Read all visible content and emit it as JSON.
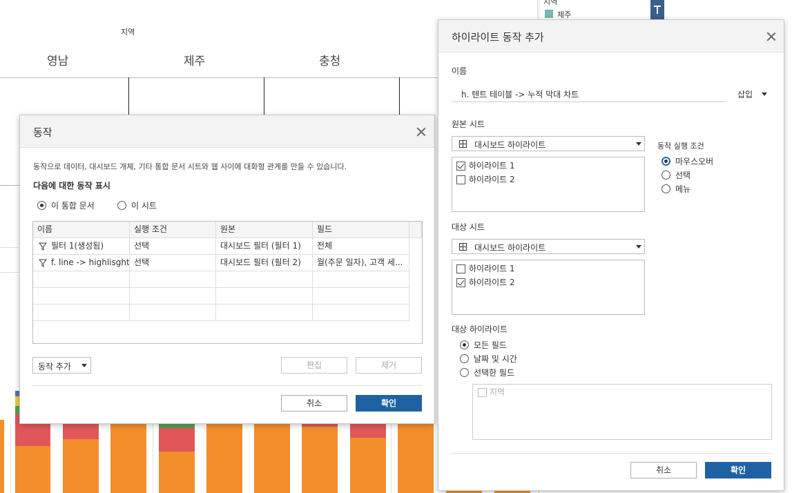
{
  "background": {
    "region_header": "지역",
    "categories": [
      "영남",
      "제주",
      "충청"
    ],
    "legend_title": "지역",
    "legend_item": "제주",
    "stack_colors": {
      "orange": "#f28e2b",
      "red": "#e15759",
      "green": "#59a14f",
      "yellow": "#edc948",
      "blue": "#4e79a7"
    }
  },
  "actions_dialog": {
    "title": "동작",
    "description": "동작으로 데이터, 대시보드 개체, 기타 통합 문서 시트와 웹 사이에 대화형 관계를 만들 수 있습니다.",
    "show_label": "다음에 대한 동작 표시",
    "scope_options": [
      {
        "label": "이 통합 문서",
        "selected": true
      },
      {
        "label": "이 시트",
        "selected": false
      }
    ],
    "table": {
      "columns": [
        "이름",
        "실행 조건",
        "원본",
        "필드"
      ],
      "rows": [
        {
          "name": "필터 1(생성됨)",
          "trigger": "선택",
          "source": "대시보드 필터 (필터 1)",
          "field": "전체"
        },
        {
          "name": "f. line -> highlisght table",
          "trigger": "선택",
          "source": "대시보드 필터 (필터 2)",
          "field": "월(주문 일자), 고객 세..."
        }
      ]
    },
    "add_action": "동작 추가",
    "edit": "편집",
    "remove": "제거",
    "cancel": "취소",
    "ok": "확인"
  },
  "highlight_dialog": {
    "title": "하이라이트 동작 추가",
    "name_label": "이름",
    "name_value": "h. 텐트 테이블  -> 누적 막대 차트",
    "insert": "삽입",
    "source_sheet_label": "원본 시트",
    "source_select": "대시보드 하이라이트",
    "source_items": [
      {
        "label": "하이라이트 1",
        "checked": true
      },
      {
        "label": "하이라이트 2",
        "checked": false
      }
    ],
    "run_on_label": "동작 실행 조건",
    "run_on_options": [
      {
        "label": "마우스오버",
        "selected": true
      },
      {
        "label": "선택",
        "selected": false
      },
      {
        "label": "메뉴",
        "selected": false
      }
    ],
    "target_sheet_label": "대상 시트",
    "target_select": "대시보드 하이라이트",
    "target_items": [
      {
        "label": "하이라이트 1",
        "checked": false
      },
      {
        "label": "하이라이트 2",
        "checked": true
      }
    ],
    "target_highlight_label": "대상 하이라이트",
    "target_highlight_options": [
      {
        "label": "모든 필드",
        "selected": true
      },
      {
        "label": "날짜 및 시간",
        "selected": false
      },
      {
        "label": "선택한 필드",
        "selected": false
      }
    ],
    "field_items": [
      {
        "label": "지역",
        "checked": false
      }
    ],
    "cancel": "취소",
    "ok": "확인"
  }
}
